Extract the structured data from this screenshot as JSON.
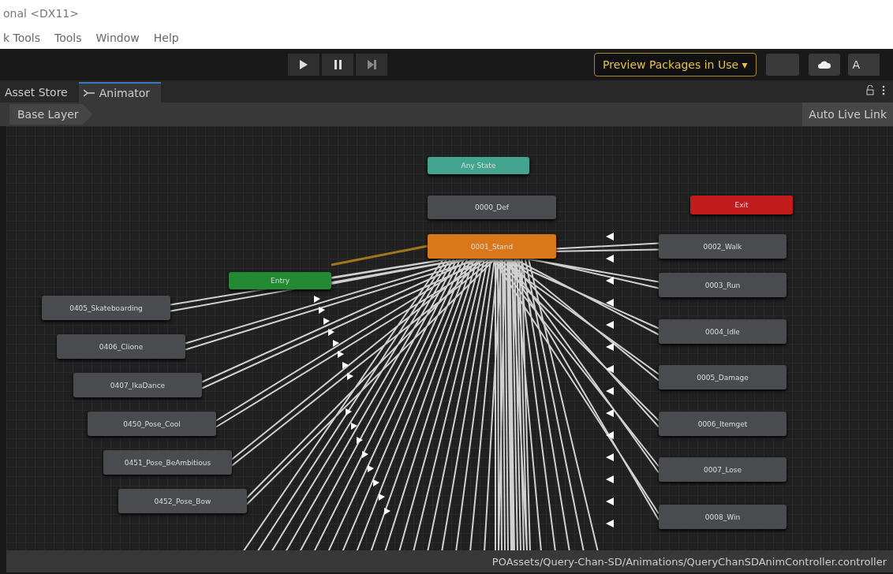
{
  "window": {
    "title": "onal <DX11>"
  },
  "menu_bar": {
    "items": [
      "k Tools",
      "Tools",
      "Window",
      "Help"
    ]
  },
  "toolbar": {
    "preview_packages": "Preview Packages in Use ▾",
    "account_button": "A"
  },
  "tabs": [
    {
      "label": "Asset Store",
      "selected": false
    },
    {
      "label": "Animator",
      "selected": true
    }
  ],
  "breadcrumb": {
    "layer": "Base Layer",
    "auto_live_link": "Auto Live Link"
  },
  "states": [
    {
      "name": "Any State",
      "kind": "any"
    },
    {
      "name": "0000_Def",
      "kind": "state"
    },
    {
      "name": "0001_Stand",
      "kind": "default"
    },
    {
      "name": "Exit",
      "kind": "exit"
    },
    {
      "name": "0002_Walk",
      "kind": "state"
    },
    {
      "name": "0003_Run",
      "kind": "state"
    },
    {
      "name": "0004_Idle",
      "kind": "state"
    },
    {
      "name": "0005_Damage",
      "kind": "state"
    },
    {
      "name": "0006_Itemget",
      "kind": "state"
    },
    {
      "name": "0007_Lose",
      "kind": "state"
    },
    {
      "name": "0008_Win",
      "kind": "state"
    },
    {
      "name": "Entry",
      "kind": "entry"
    },
    {
      "name": "0405_Skateboarding",
      "kind": "state"
    },
    {
      "name": "0406_Clione",
      "kind": "state"
    },
    {
      "name": "0407_IkaDance",
      "kind": "state"
    },
    {
      "name": "0450_Pose_Cool",
      "kind": "state"
    },
    {
      "name": "0451_Pose_BeAmbitious",
      "kind": "state"
    },
    {
      "name": "0452_Pose_Bow",
      "kind": "state"
    }
  ],
  "status_bar": {
    "path": "POAssets/Query-Chan-SD/Animations/QueryChanSDAnimController.controller"
  }
}
